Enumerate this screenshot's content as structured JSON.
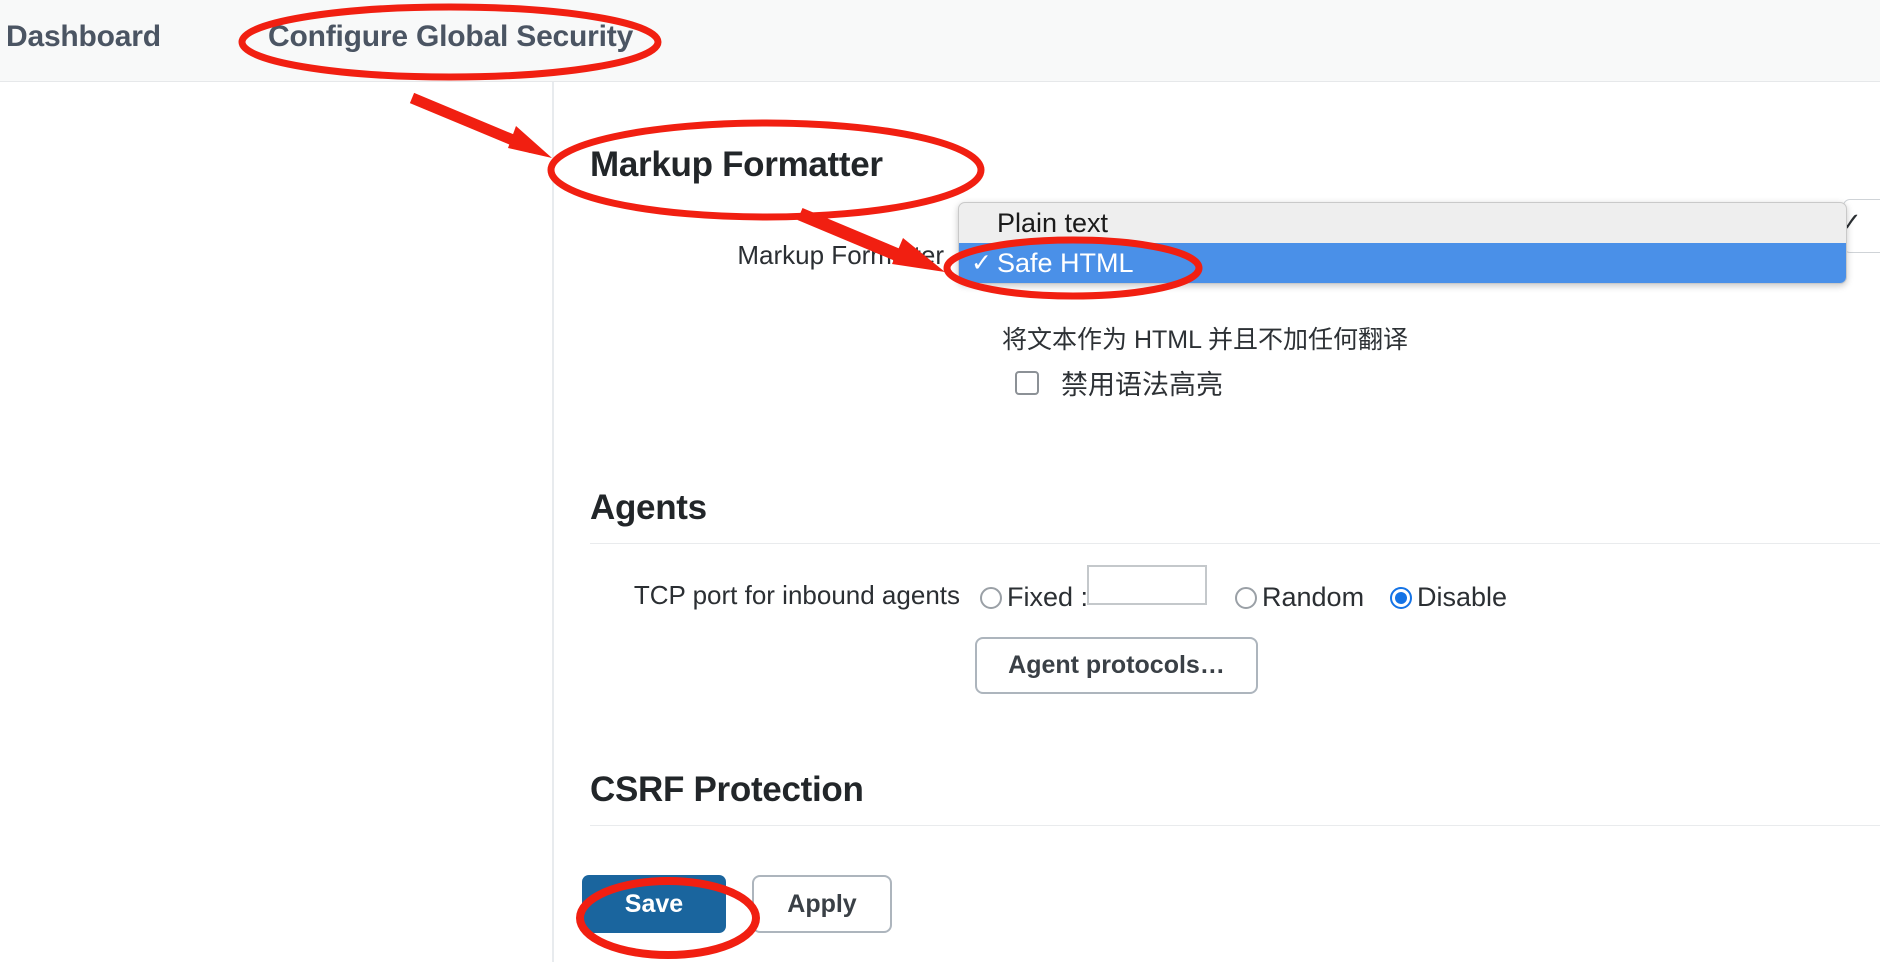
{
  "header": {
    "breadcrumb": {
      "dashboard": "Dashboard",
      "current": "Configure Global Security"
    }
  },
  "sections": {
    "markup_formatter": {
      "title": "Markup Formatter",
      "field_label": "Markup Formatter",
      "select": {
        "selected_value": "Safe HTML",
        "options": [
          {
            "label": "Plain text",
            "selected": false,
            "check": ""
          },
          {
            "label": "Safe HTML",
            "selected": true,
            "check": "✓"
          }
        ]
      },
      "help_text": "将文本作为 HTML 并且不加任何翻译",
      "checkbox": {
        "label": "禁用语法高亮",
        "checked": false
      }
    },
    "agents": {
      "title": "Agents",
      "tcp_label": "TCP port for inbound agents",
      "options": [
        {
          "label": "Fixed :",
          "selected": false
        },
        {
          "label": "Random",
          "selected": false
        },
        {
          "label": "Disable",
          "selected": true
        }
      ],
      "fixed_port_value": "",
      "fixed_port_placeholder": "",
      "agent_protocols_button": "Agent protocols…"
    },
    "csrf": {
      "title": "CSRF Protection"
    }
  },
  "footer": {
    "save_label": "Save",
    "apply_label": "Apply"
  },
  "annotations": {
    "color": "#f11f11",
    "ellipses": [
      "Configure Global Security",
      "Markup Formatter",
      "Safe HTML",
      "Save"
    ],
    "arrows": [
      "breadcrumb-to-markup-formatter-heading",
      "markup-formatter-heading-to-safe-html-option"
    ]
  },
  "colors": {
    "accent_blue": "#4a90e8",
    "radio_blue": "#1473e6",
    "save_blue": "#1a659e",
    "annotation_red": "#f11f11"
  }
}
